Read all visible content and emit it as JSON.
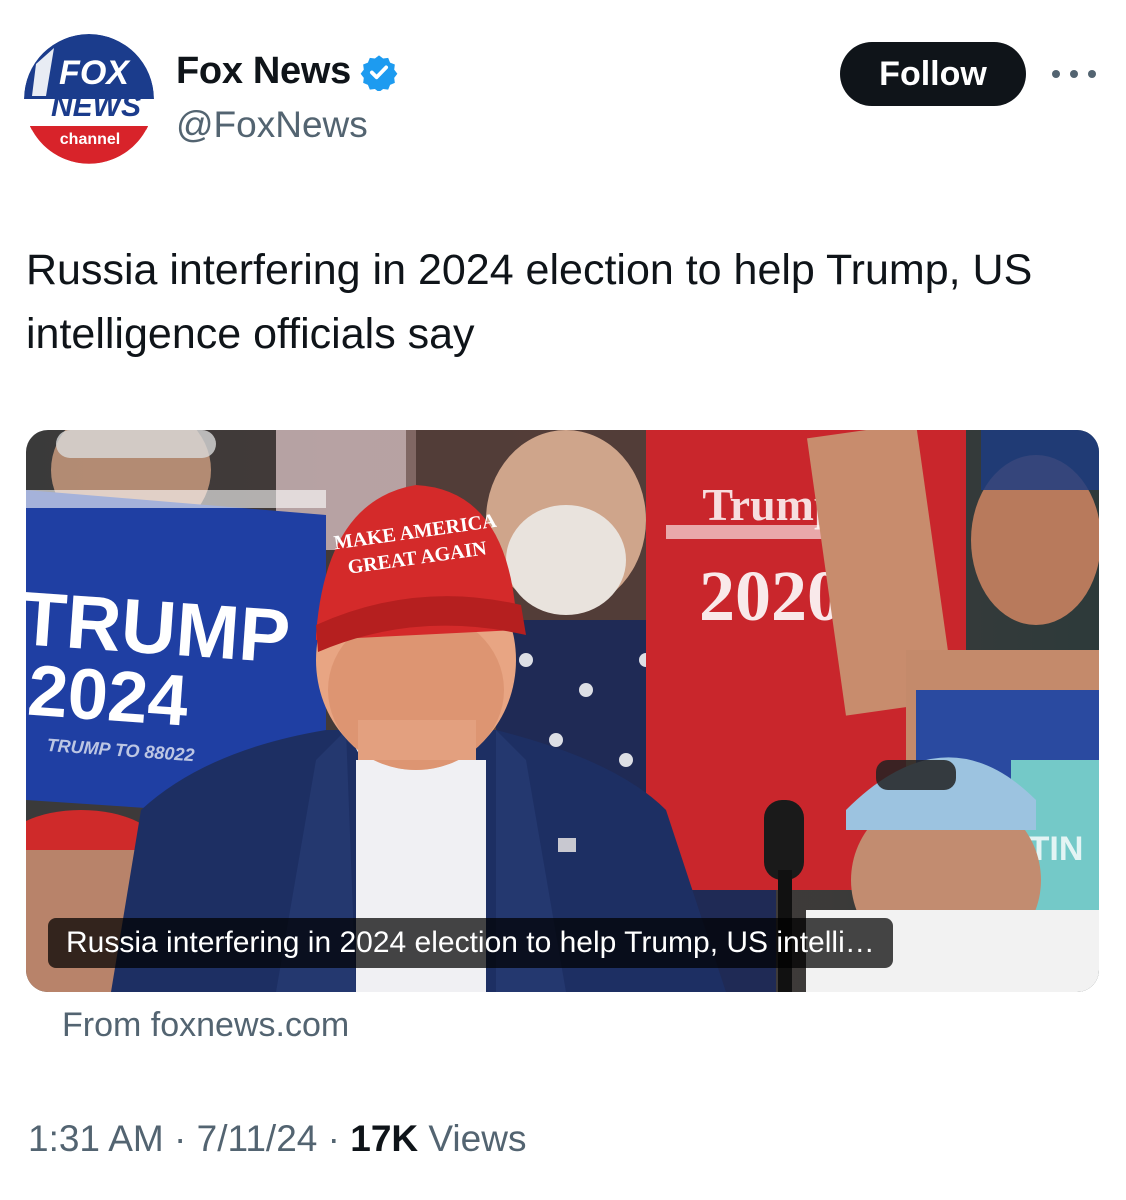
{
  "author": {
    "display_name": "Fox News",
    "handle": "@FoxNews",
    "avatar_text": {
      "line1": "FOX",
      "line2": "NEWS",
      "line3": "channel"
    },
    "verified_icon": "verified-badge-icon"
  },
  "actions": {
    "follow_label": "Follow",
    "more_icon": "more-options-icon"
  },
  "tweet": {
    "text": "Russia interfering in 2024 election to help Trump, US intelligence officials say"
  },
  "card": {
    "caption": "Russia interfering in 2024 election to help Trump, US intelli…",
    "source": "From foxnews.com",
    "image_text": {
      "hat_line1": "MAKE AMERICA",
      "hat_line2": "GREAT AGAIN",
      "sign_line1": "TRUMP",
      "sign_line2": "2024",
      "sign_line3": "TRUMP TO 88022",
      "shirt_line1": "Trump",
      "shirt_line2": "2020",
      "right_sign": "TIN"
    }
  },
  "meta": {
    "time": "1:31 AM",
    "date": "7/11/24",
    "views_count": "17K",
    "views_label": "Views",
    "separator": "·"
  },
  "colors": {
    "text_primary": "#0f1419",
    "text_secondary": "#536471",
    "verified_blue": "#1d9bf0",
    "fox_blue": "#1b3c8c",
    "fox_red": "#d8232a",
    "maga_red": "#d42a2a"
  }
}
